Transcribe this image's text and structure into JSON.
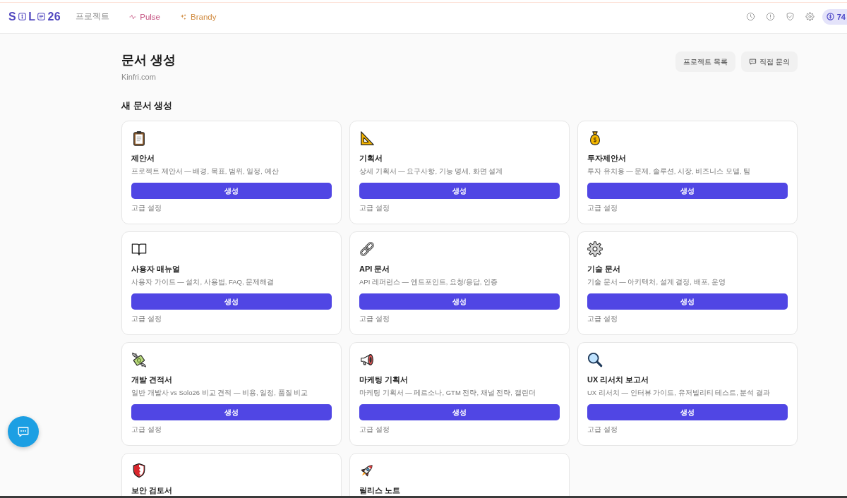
{
  "nav": {
    "logo": [
      "S",
      "L",
      "26"
    ],
    "items": [
      {
        "label": "프로젝트",
        "color": "#8c8c8c"
      },
      {
        "label": "Pulse",
        "color": "#c4507f"
      },
      {
        "label": "Brandy",
        "color": "#d08a3e"
      }
    ],
    "credits": "74"
  },
  "header": {
    "title": "문서 생성",
    "subtitle": "Kinfri.com",
    "buttons": [
      "프로젝트 목록",
      "직접 문의"
    ]
  },
  "section": {
    "title": "새 문서 생성",
    "cards": [
      {
        "title": "제안서",
        "description": "프로젝트 제안서 — 배경, 목표, 범위, 일정, 예산",
        "button": "생성",
        "link": "고급 설정"
      },
      {
        "title": "기획서",
        "description": "상세 기획서 — 요구사항, 기능 명세, 화면 설계",
        "button": "생성",
        "link": "고급 설정"
      },
      {
        "title": "투자제안서",
        "description": "투자 유치용 — 문제, 솔루션, 시장, 비즈니스 모델, 팀",
        "button": "생성",
        "link": "고급 설정"
      },
      {
        "title": "사용자 매뉴얼",
        "description": "사용자 가이드 — 설치, 사용법, FAQ, 문제해결",
        "button": "생성",
        "link": "고급 설정"
      },
      {
        "title": "API 문서",
        "description": "API 레퍼런스 — 엔드포인트, 요청/응답, 인증",
        "button": "생성",
        "link": "고급 설정"
      },
      {
        "title": "기술 문서",
        "description": "기술 문서 — 아키텍처, 설계 결정, 배포, 운영",
        "button": "생성",
        "link": "고급 설정"
      },
      {
        "title": "개발 견적서",
        "description": "일반 개발사 vs Solo26 비교 견적 — 비용, 일정, 품질 비교",
        "button": "생성",
        "link": "고급 설정"
      },
      {
        "title": "마케팅 기획서",
        "description": "마케팅 기획서 — 페르소나, GTM 전략, 채널 전략, 캘린더",
        "button": "생성",
        "link": "고급 설정"
      },
      {
        "title": "UX 리서치 보고서",
        "description": "UX 리서치 — 인터뷰 가이드, 유저빌리티 테스트, 분석 결과",
        "button": "생성",
        "link": "고급 설정"
      },
      {
        "title": "보안 검토서"
      },
      {
        "title": "릴리스 노트"
      }
    ]
  }
}
